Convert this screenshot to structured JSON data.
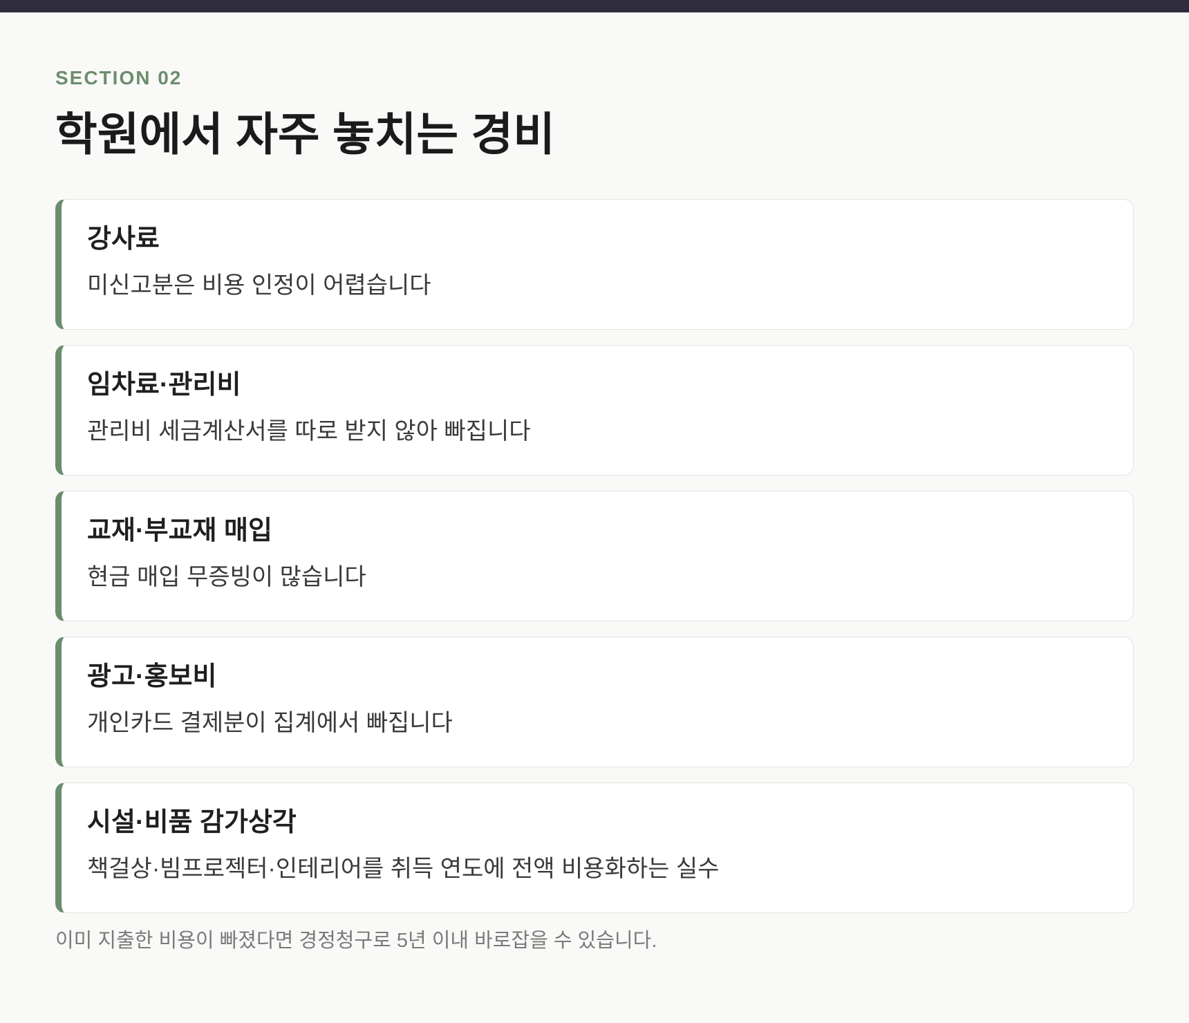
{
  "section_label": "SECTION 02",
  "title": "학원에서 자주 놓치는 경비",
  "accent_color": "#6b8d6e",
  "cards": [
    {
      "title": "강사료",
      "description": "미신고분은 비용 인정이 어렵습니다"
    },
    {
      "title": "임차료·관리비",
      "description": "관리비 세금계산서를 따로 받지 않아 빠집니다"
    },
    {
      "title": "교재·부교재 매입",
      "description": "현금 매입 무증빙이 많습니다"
    },
    {
      "title": "광고·홍보비",
      "description": "개인카드 결제분이 집계에서 빠집니다"
    },
    {
      "title": "시설·비품 감가상각",
      "description": "책걸상·빔프로젝터·인테리어를 취득 연도에 전액 비용화하는 실수"
    }
  ],
  "footnote": "이미 지출한 비용이 빠졌다면 경정청구로 5년 이내 바로잡을 수 있습니다."
}
